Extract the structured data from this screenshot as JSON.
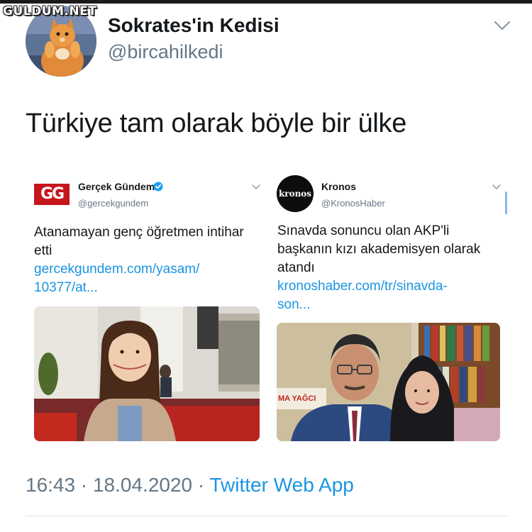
{
  "watermark": "GULDUM.NET",
  "tweet": {
    "display_name": "Sokrates'in Kedisi",
    "handle": "@bircahilkedi",
    "text": "Türkiye tam olarak böyle bir ülke",
    "time": "16:43",
    "date": "18.04.2020",
    "separator": "·",
    "source": "Twitter Web App"
  },
  "quoted_cards": [
    {
      "logo_text": "GG",
      "name": "Gerçek Gündem",
      "verified": true,
      "handle": "@gercekgundem",
      "text": "Atanamayan genç öğretmen intihar etti",
      "link_line1": "gercekgundem.com/yasam/",
      "link_line2": "10377/at..."
    },
    {
      "logo_text": "kronos",
      "name": "Kronos",
      "verified": false,
      "handle": "@KronosHaber",
      "text_line1": "Sınavda sonuncu olan AKP'li",
      "text_line2": "başkanın kızı akademisyen olarak",
      "text_line3": "atandı",
      "link_line1": "kronoshaber.com/tr/sinavda-",
      "link_line2": "son...",
      "photo_sign_text": "MA YAĞCI"
    }
  ],
  "icons": {
    "caret": "chevron-down-icon",
    "verified": "verified-badge-icon"
  },
  "colors": {
    "link": "#1b95e0",
    "secondary": "#657786",
    "primary": "#14171a",
    "gg_red": "#c4161c"
  }
}
